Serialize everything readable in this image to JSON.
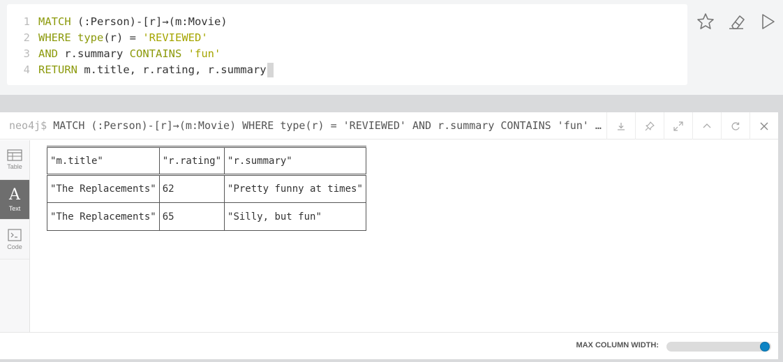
{
  "editor": {
    "lines": [
      {
        "no": "1",
        "parts": [
          {
            "t": "MATCH",
            "c": "kw"
          },
          {
            "t": " (:Person)-[r]→(m:Movie)",
            "c": ""
          }
        ]
      },
      {
        "no": "2",
        "parts": [
          {
            "t": "WHERE",
            "c": "kw"
          },
          {
            "t": " ",
            "c": ""
          },
          {
            "t": "type",
            "c": "kw"
          },
          {
            "t": "(r) = ",
            "c": ""
          },
          {
            "t": "'REVIEWED'",
            "c": "str"
          }
        ]
      },
      {
        "no": "3",
        "parts": [
          {
            "t": "AND",
            "c": "kw"
          },
          {
            "t": " r.summary ",
            "c": ""
          },
          {
            "t": "CONTAINS",
            "c": "kw"
          },
          {
            "t": " ",
            "c": ""
          },
          {
            "t": "'fun'",
            "c": "str"
          }
        ]
      },
      {
        "no": "4",
        "parts": [
          {
            "t": "RETURN",
            "c": "kw"
          },
          {
            "t": " m.title, r.rating, r.summary",
            "c": ""
          }
        ]
      }
    ],
    "actions": [
      "star-icon",
      "eraser-icon",
      "play-icon"
    ]
  },
  "frame": {
    "prompt": "neo4j$",
    "query": " MATCH (:Person)-[r]→(m:Movie) WHERE type(r) = 'REVIEWED' AND r.summary CONTAINS 'fun' RETURN m.title, r.rating, r.summary",
    "tools": [
      "download-icon",
      "pin-icon",
      "expand-icon",
      "collapse-icon",
      "rerun-icon",
      "close-icon"
    ]
  },
  "sidebar": {
    "items": [
      {
        "label": "Table",
        "icon": "table-icon",
        "active": false
      },
      {
        "label": "Text",
        "icon": "text-icon",
        "active": true
      },
      {
        "label": "Code",
        "icon": "code-icon",
        "active": false
      }
    ]
  },
  "result": {
    "columns": [
      "\"m.title\"",
      "\"r.rating\"",
      "\"r.summary\""
    ],
    "rows": [
      [
        "\"The Replacements\"",
        "62",
        "\"Pretty funny at times\""
      ],
      [
        "\"The Replacements\"",
        "65",
        "\"Silly, but fun\""
      ]
    ]
  },
  "footer": {
    "max_column_width_label": "MAX COLUMN WIDTH:",
    "max_column_width_value": 1.0
  },
  "colors": {
    "keyword": "#8c9a0c",
    "slider_accent": "#0d84c5",
    "active_tab": "#6e6e6e"
  }
}
